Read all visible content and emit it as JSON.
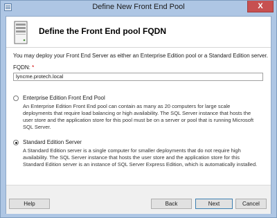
{
  "window": {
    "title": "Define New Front End Pool",
    "close_label": "X"
  },
  "header": {
    "title": "Define the Front End pool FQDN"
  },
  "intro_text": "You may deploy your Front End Server as either an Enterprise Edition pool or a Standard Edition server.",
  "fqdn": {
    "label": "FQDN:",
    "required_mark": "*",
    "value": "lyncme.protech.local"
  },
  "options": [
    {
      "label": "Enterprise Edition Front End Pool",
      "selected": false,
      "description": [
        "An Enterprise Edition Front End pool can contain as many as 20 computers for large scale",
        "deployments that require load balancing or high availability. The SQL Server instance that hosts the",
        "user store and the application store for this pool must be on a server or pool that is running Microsoft",
        "SQL Server."
      ]
    },
    {
      "label": "Standard Edition Server",
      "selected": true,
      "description": [
        "A Standard Edition server is a single computer for smaller deployments that do not require high",
        "availability. The SQL Server instance that hosts the user store and the application store for this",
        "Standard Edition server is an instance of SQL Server Express Edition, which is automatically installed."
      ]
    }
  ],
  "buttons": {
    "help": "Help",
    "back": "Back",
    "next": "Next",
    "cancel": "Cancel"
  }
}
